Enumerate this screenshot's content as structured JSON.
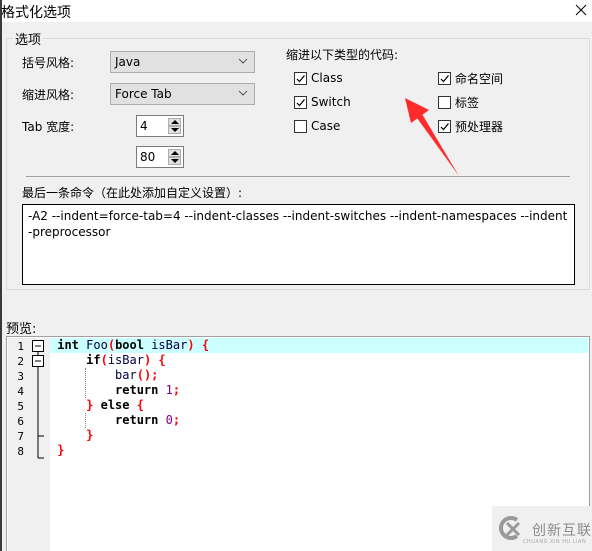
{
  "window": {
    "title": "格式化选项",
    "close_icon": "close-icon"
  },
  "options_group": {
    "label": "选项",
    "bracket_style": {
      "label": "括号风格:",
      "value": "Java"
    },
    "indent_style": {
      "label": "缩进风格:",
      "value": "Force Tab"
    },
    "tab_width": {
      "label": "Tab 宽度:",
      "value": "4"
    },
    "max_width": {
      "value": "80"
    },
    "indent_types": {
      "label": "缩进以下类型的代码:",
      "items": [
        {
          "label": "Class",
          "checked": true
        },
        {
          "label": "Switch",
          "checked": true
        },
        {
          "label": "Case",
          "checked": false
        },
        {
          "label": "命名空间",
          "checked": true
        },
        {
          "label": "标签",
          "checked": false
        },
        {
          "label": "预处理器",
          "checked": true
        }
      ]
    },
    "command": {
      "label": "最后一条命令（在此处添加自定义设置）:",
      "value": "-A2 --indent=force-tab=4 --indent-classes --indent-switches --indent-namespaces --indent-preprocessor"
    }
  },
  "preview": {
    "label": "预览:",
    "line_numbers": [
      "1",
      "2",
      "3",
      "4",
      "5",
      "6",
      "7",
      "8"
    ],
    "highlighted_line": 1,
    "lines": [
      [
        {
          "t": "int",
          "c": "kw"
        },
        {
          "t": " ",
          "c": "id"
        },
        {
          "t": "Foo",
          "c": "id"
        },
        {
          "t": "(",
          "c": "op"
        },
        {
          "t": "bool",
          "c": "kw"
        },
        {
          "t": " isBar",
          "c": "id"
        },
        {
          "t": ")",
          "c": "op"
        },
        {
          "t": " ",
          "c": "id"
        },
        {
          "t": "{",
          "c": "op"
        }
      ],
      [
        {
          "t": "    ",
          "c": "id"
        },
        {
          "t": "if",
          "c": "kw"
        },
        {
          "t": "(",
          "c": "op"
        },
        {
          "t": "isBar",
          "c": "id"
        },
        {
          "t": ")",
          "c": "op"
        },
        {
          "t": " ",
          "c": "id"
        },
        {
          "t": "{",
          "c": "op"
        }
      ],
      [
        {
          "t": "        ",
          "c": "id"
        },
        {
          "t": "bar",
          "c": "id"
        },
        {
          "t": "();",
          "c": "op"
        }
      ],
      [
        {
          "t": "        ",
          "c": "id"
        },
        {
          "t": "return",
          "c": "kw"
        },
        {
          "t": " ",
          "c": "id"
        },
        {
          "t": "1",
          "c": "num"
        },
        {
          "t": ";",
          "c": "op"
        }
      ],
      [
        {
          "t": "    ",
          "c": "id"
        },
        {
          "t": "}",
          "c": "op"
        },
        {
          "t": " ",
          "c": "id"
        },
        {
          "t": "else",
          "c": "kw"
        },
        {
          "t": " ",
          "c": "id"
        },
        {
          "t": "{",
          "c": "op"
        }
      ],
      [
        {
          "t": "        ",
          "c": "id"
        },
        {
          "t": "return",
          "c": "kw"
        },
        {
          "t": " ",
          "c": "id"
        },
        {
          "t": "0",
          "c": "num"
        },
        {
          "t": ";",
          "c": "op"
        }
      ],
      [
        {
          "t": "    ",
          "c": "id"
        },
        {
          "t": "}",
          "c": "op"
        }
      ],
      [
        {
          "t": "}",
          "c": "op"
        }
      ]
    ]
  },
  "annotation": {
    "arrow_color": "#ff2a2a"
  },
  "watermark": {
    "text": "创新互联",
    "subtext": "CHUANG XIN HU LIAN"
  }
}
